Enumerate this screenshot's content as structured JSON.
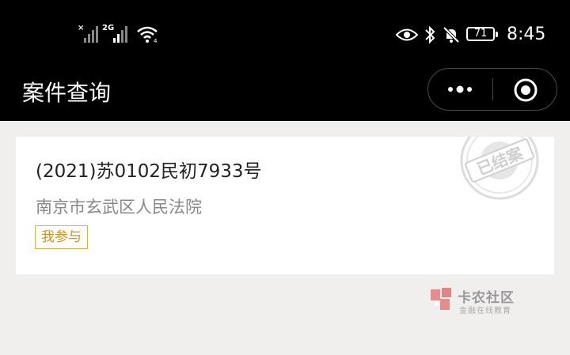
{
  "status_bar": {
    "network_1": "×",
    "network_2": "2G",
    "battery_level": "71",
    "time": "8:45",
    "icons": [
      "signal-icon",
      "signal-icon",
      "wifi-icon",
      "eye-icon",
      "bluetooth-icon",
      "mute-bell-icon",
      "battery-icon"
    ]
  },
  "nav": {
    "title": "案件查询",
    "capsule_icons": [
      "more-dots-icon",
      "close-target-icon"
    ]
  },
  "case_card": {
    "case_number": "(2021)苏0102民初7933号",
    "court": "南京市玄武区人民法院",
    "role_tag": "我参与",
    "stamp_text": "已结案"
  },
  "watermark": {
    "brand": "卡农社区",
    "subtitle": "金融在线教育"
  },
  "colors": {
    "header_bg": "#000000",
    "page_bg": "#f1efee",
    "tag_border": "#e0b050",
    "tag_text": "#c9952b",
    "stamp": "#d0d0d0"
  }
}
